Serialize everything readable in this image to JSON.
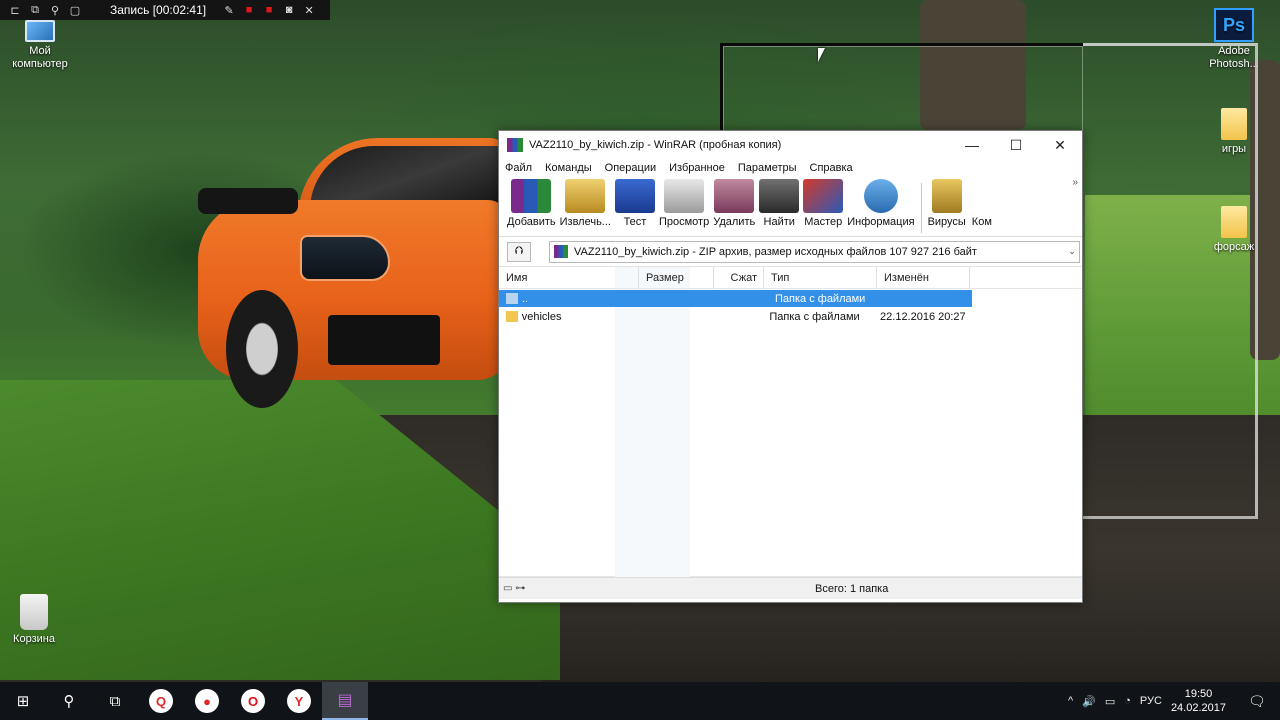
{
  "recorder": {
    "title": "Запись [00:02:41]",
    "icons": [
      "pin-icon",
      "window-icon",
      "zoom-icon",
      "region-icon",
      "pen-icon",
      "stop-icon",
      "pause-icon",
      "camera-icon",
      "close-icon"
    ]
  },
  "desktop": {
    "icons": [
      {
        "label_line1": "Мой",
        "label_line2": "компьютер",
        "icon": "computer-icon"
      },
      {
        "label_line1": "Корзина",
        "label_line2": "",
        "icon": "recycle-bin-icon"
      },
      {
        "label_line1": "Adobe",
        "label_line2": "Photosh...",
        "icon": "photoshop-icon",
        "glyph": "Ps"
      },
      {
        "label_line1": "игры",
        "label_line2": "",
        "icon": "folder-icon"
      },
      {
        "label_line1": "форсаж",
        "label_line2": "",
        "icon": "folder-icon"
      }
    ]
  },
  "window": {
    "title": "VAZ2110_by_kiwich.zip - WinRAR (пробная копия)",
    "controls": {
      "minimize": "—",
      "maximize": "☐",
      "close": "✕"
    },
    "menu": [
      "Файл",
      "Команды",
      "Операции",
      "Избранное",
      "Параметры",
      "Справка"
    ],
    "toolbar": [
      {
        "label": "Добавить",
        "icon": "add-archive-icon",
        "color": "#7a2a8a"
      },
      {
        "label": "Извлечь...",
        "icon": "extract-folder-icon",
        "color": "#c9a440"
      },
      {
        "label": "Тест",
        "icon": "test-book-icon",
        "color": "#2a5ab8"
      },
      {
        "label": "Просмотр",
        "icon": "view-glasses-icon",
        "color": "#8a8a8a"
      },
      {
        "label": "Удалить",
        "icon": "delete-icon",
        "color": "#a0485a"
      },
      {
        "label": "Найти",
        "icon": "find-binoculars-icon",
        "color": "#4a4a4a"
      },
      {
        "label": "Мастер",
        "icon": "wizard-icon",
        "color": "#c23a2a"
      },
      {
        "label": "Информация",
        "icon": "info-icon",
        "color": "#2a78c2"
      },
      {
        "label": "Вирусы",
        "icon": "virus-scan-icon",
        "color": "#c9a030"
      },
      {
        "label": "Ком",
        "icon": "comment-icon",
        "color": "#ffffff"
      }
    ],
    "more_glyph": "»",
    "path": {
      "up_glyph": "⮉",
      "text": "VAZ2110_by_kiwich.zip - ZIP архив, размер исходных файлов 107 927 216 байт",
      "dropdown_glyph": "⌄"
    },
    "columns": [
      "Имя",
      "Размер",
      "Сжат",
      "Тип",
      "Изменён"
    ],
    "rows": [
      {
        "name": "..",
        "size": "",
        "packed": "",
        "type": "Папка с файлами",
        "modified": "",
        "selected": true
      },
      {
        "name": "vehicles",
        "size": "",
        "packed": "",
        "type": "Папка с файлами",
        "modified": "22.12.2016 20:27",
        "selected": false
      }
    ],
    "status": {
      "icons": "▭ ⊶",
      "text": "Всего: 1 папка"
    }
  },
  "taskbar": {
    "start_glyph": "⊞",
    "search_glyph": "⚲",
    "taskview_glyph": "⧉",
    "apps": [
      {
        "glyph": "Q",
        "icon": "search-app-icon",
        "color": "#e02a2a"
      },
      {
        "glyph": "●",
        "icon": "microphone-icon",
        "color": "#e02a2a"
      },
      {
        "glyph": "O",
        "icon": "opera-icon",
        "color": "#e0101a"
      },
      {
        "glyph": "Y",
        "icon": "yandex-browser-icon",
        "color": "#ffffff"
      },
      {
        "glyph": "▤",
        "icon": "winrar-icon",
        "color": "#7a2a8a"
      }
    ],
    "tray": {
      "chevron": "^",
      "volume": "🔊",
      "battery": "▭",
      "wifi": "◔",
      "lang": "РУС"
    },
    "time": "19:50",
    "date": "24.02.2017",
    "notifications_glyph": "🗨"
  }
}
